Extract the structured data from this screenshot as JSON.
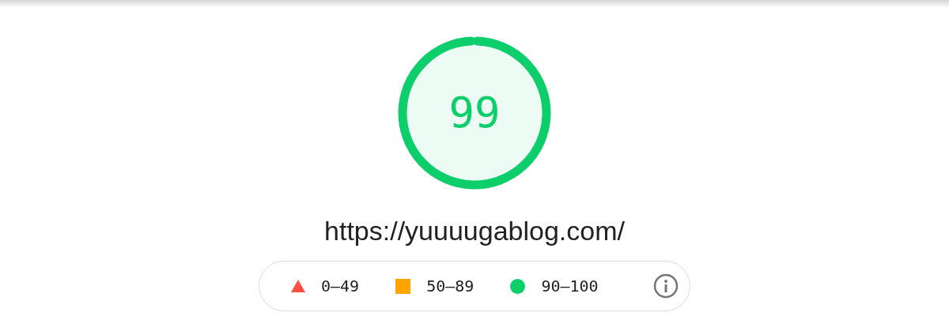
{
  "gauge": {
    "score": "99",
    "color": "#0cce6b"
  },
  "url": "https://yuuuugablog.com/",
  "legend": [
    {
      "kind": "triangle",
      "color": "#ff4e42",
      "range": "0–49"
    },
    {
      "kind": "square",
      "color": "#ffa400",
      "range": "50–89"
    },
    {
      "kind": "circle",
      "color": "#0cce6b",
      "range": "90–100"
    }
  ]
}
